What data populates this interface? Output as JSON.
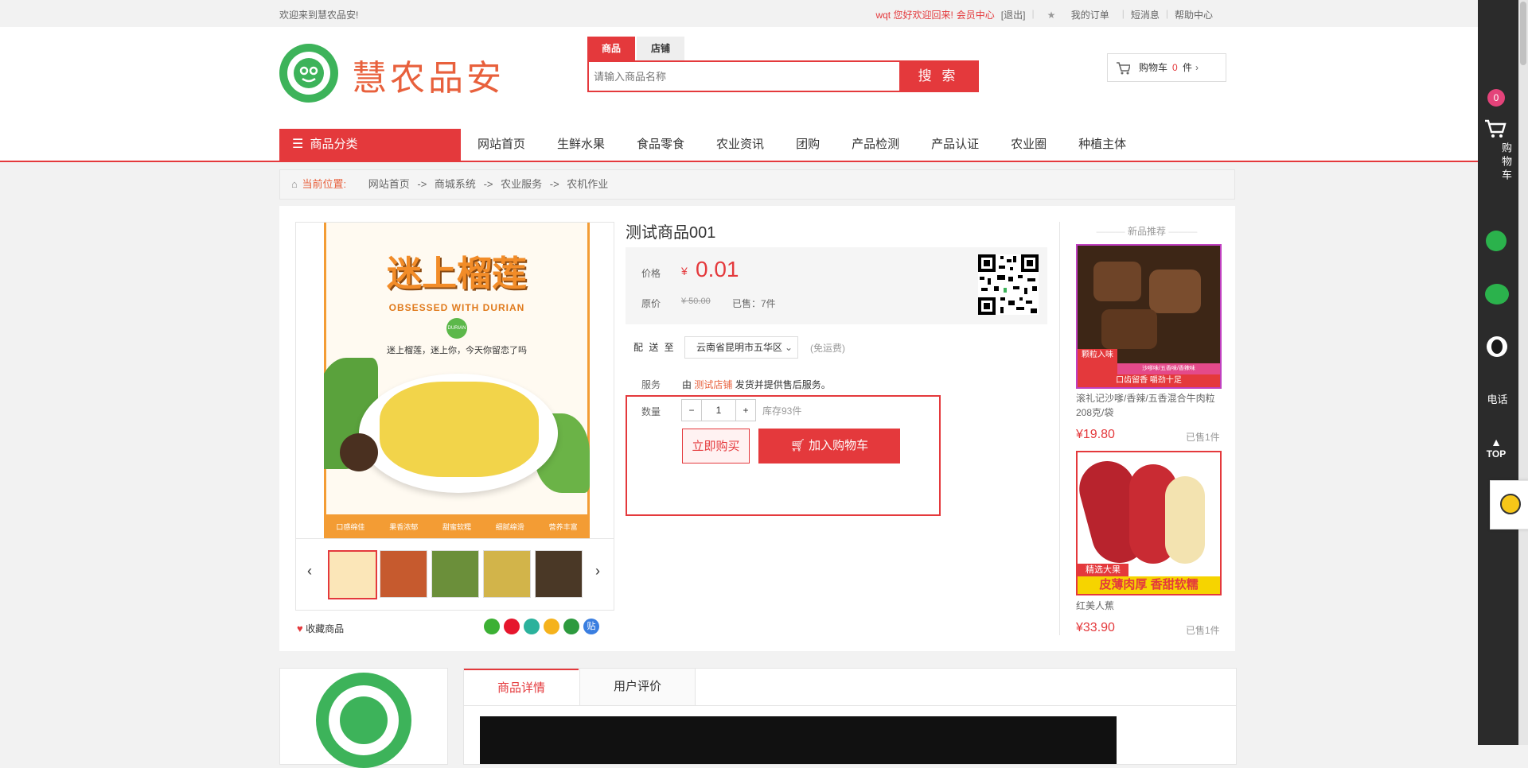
{
  "topbar": {
    "welcome": "欢迎来到慧农品安!",
    "user_greeting": "wqt 您好欢迎回来!",
    "member_center": "会员中心",
    "logout": "[退出]",
    "my_orders": "我的订单",
    "messages": "短消息",
    "help": "帮助中心"
  },
  "header": {
    "brand": "慧农品安",
    "search_tabs": [
      "商品",
      "店铺"
    ],
    "search_placeholder": "请输入商品名称",
    "search_button": "搜 索",
    "cart_label": "购物车",
    "cart_count": "0",
    "cart_unit": "件"
  },
  "nav": {
    "category_label": "商品分类",
    "items": [
      "网站首页",
      "生鲜水果",
      "食品零食",
      "农业资讯",
      "团购",
      "产品检测",
      "产品认证",
      "农业圈",
      "种植主体"
    ]
  },
  "breadcrumb": {
    "label": "当前位置:",
    "items": [
      "网站首页",
      "商城系统",
      "农业服务",
      "农机作业"
    ],
    "sep": "->"
  },
  "product": {
    "image_title": "迷上榴莲",
    "image_subtitle": "OBSESSED WITH DURIAN",
    "image_tagline": "迷上榴莲，迷上你，今天你留恋了吗",
    "image_badge": "DURIAN",
    "image_features": [
      "口感绵佳",
      "果香浓郁",
      "甜蜜软糯",
      "细腻绵滑",
      "营养丰富"
    ],
    "title": "测试商品001",
    "price_label": "价格",
    "currency": "¥",
    "price": "0.01",
    "orig_label": "原价",
    "orig_price": "¥ 50.00",
    "sold": "已售：7件",
    "ship_label": "配 送 至",
    "ship_location": "云南省昆明市五华区",
    "ship_fee": "(免运费)",
    "service_label": "服务",
    "service_prefix": "由",
    "service_shop": "测试店铺",
    "service_suffix": "发货并提供售后服务。",
    "qty_label": "数量",
    "qty_minus": "−",
    "qty_value": "1",
    "qty_plus": "+",
    "stock": "库存93件",
    "buy_now": "立即购买",
    "add_cart": "加入购物车",
    "favorite": "收藏商品"
  },
  "recommend": {
    "title": "新品推荐",
    "items": [
      {
        "name": "滚礼记沙嗲/香辣/五香混合牛肉粒208克/袋",
        "price": "¥19.80",
        "sold": "已售1件",
        "img_text": "口齿留香 嚼劲十足",
        "img_tag": "颗粒入味",
        "img_tag2": "沙嗲味/五香味/香辣味"
      },
      {
        "name": "红美人蕉",
        "price": "¥33.90",
        "sold": "已售1件",
        "img_text": "皮薄肉厚 香甜软糯",
        "img_tag": "精选大果"
      }
    ]
  },
  "detail": {
    "tabs": [
      "商品详情",
      "用户评价"
    ]
  },
  "sidebar": {
    "cart_count": "0",
    "cart_label": "购物车",
    "phone": "电话",
    "top": "TOP"
  },
  "colors": {
    "accent": "#e4393c",
    "brand_green": "#3db35a",
    "brand_orange": "#e8603c"
  }
}
